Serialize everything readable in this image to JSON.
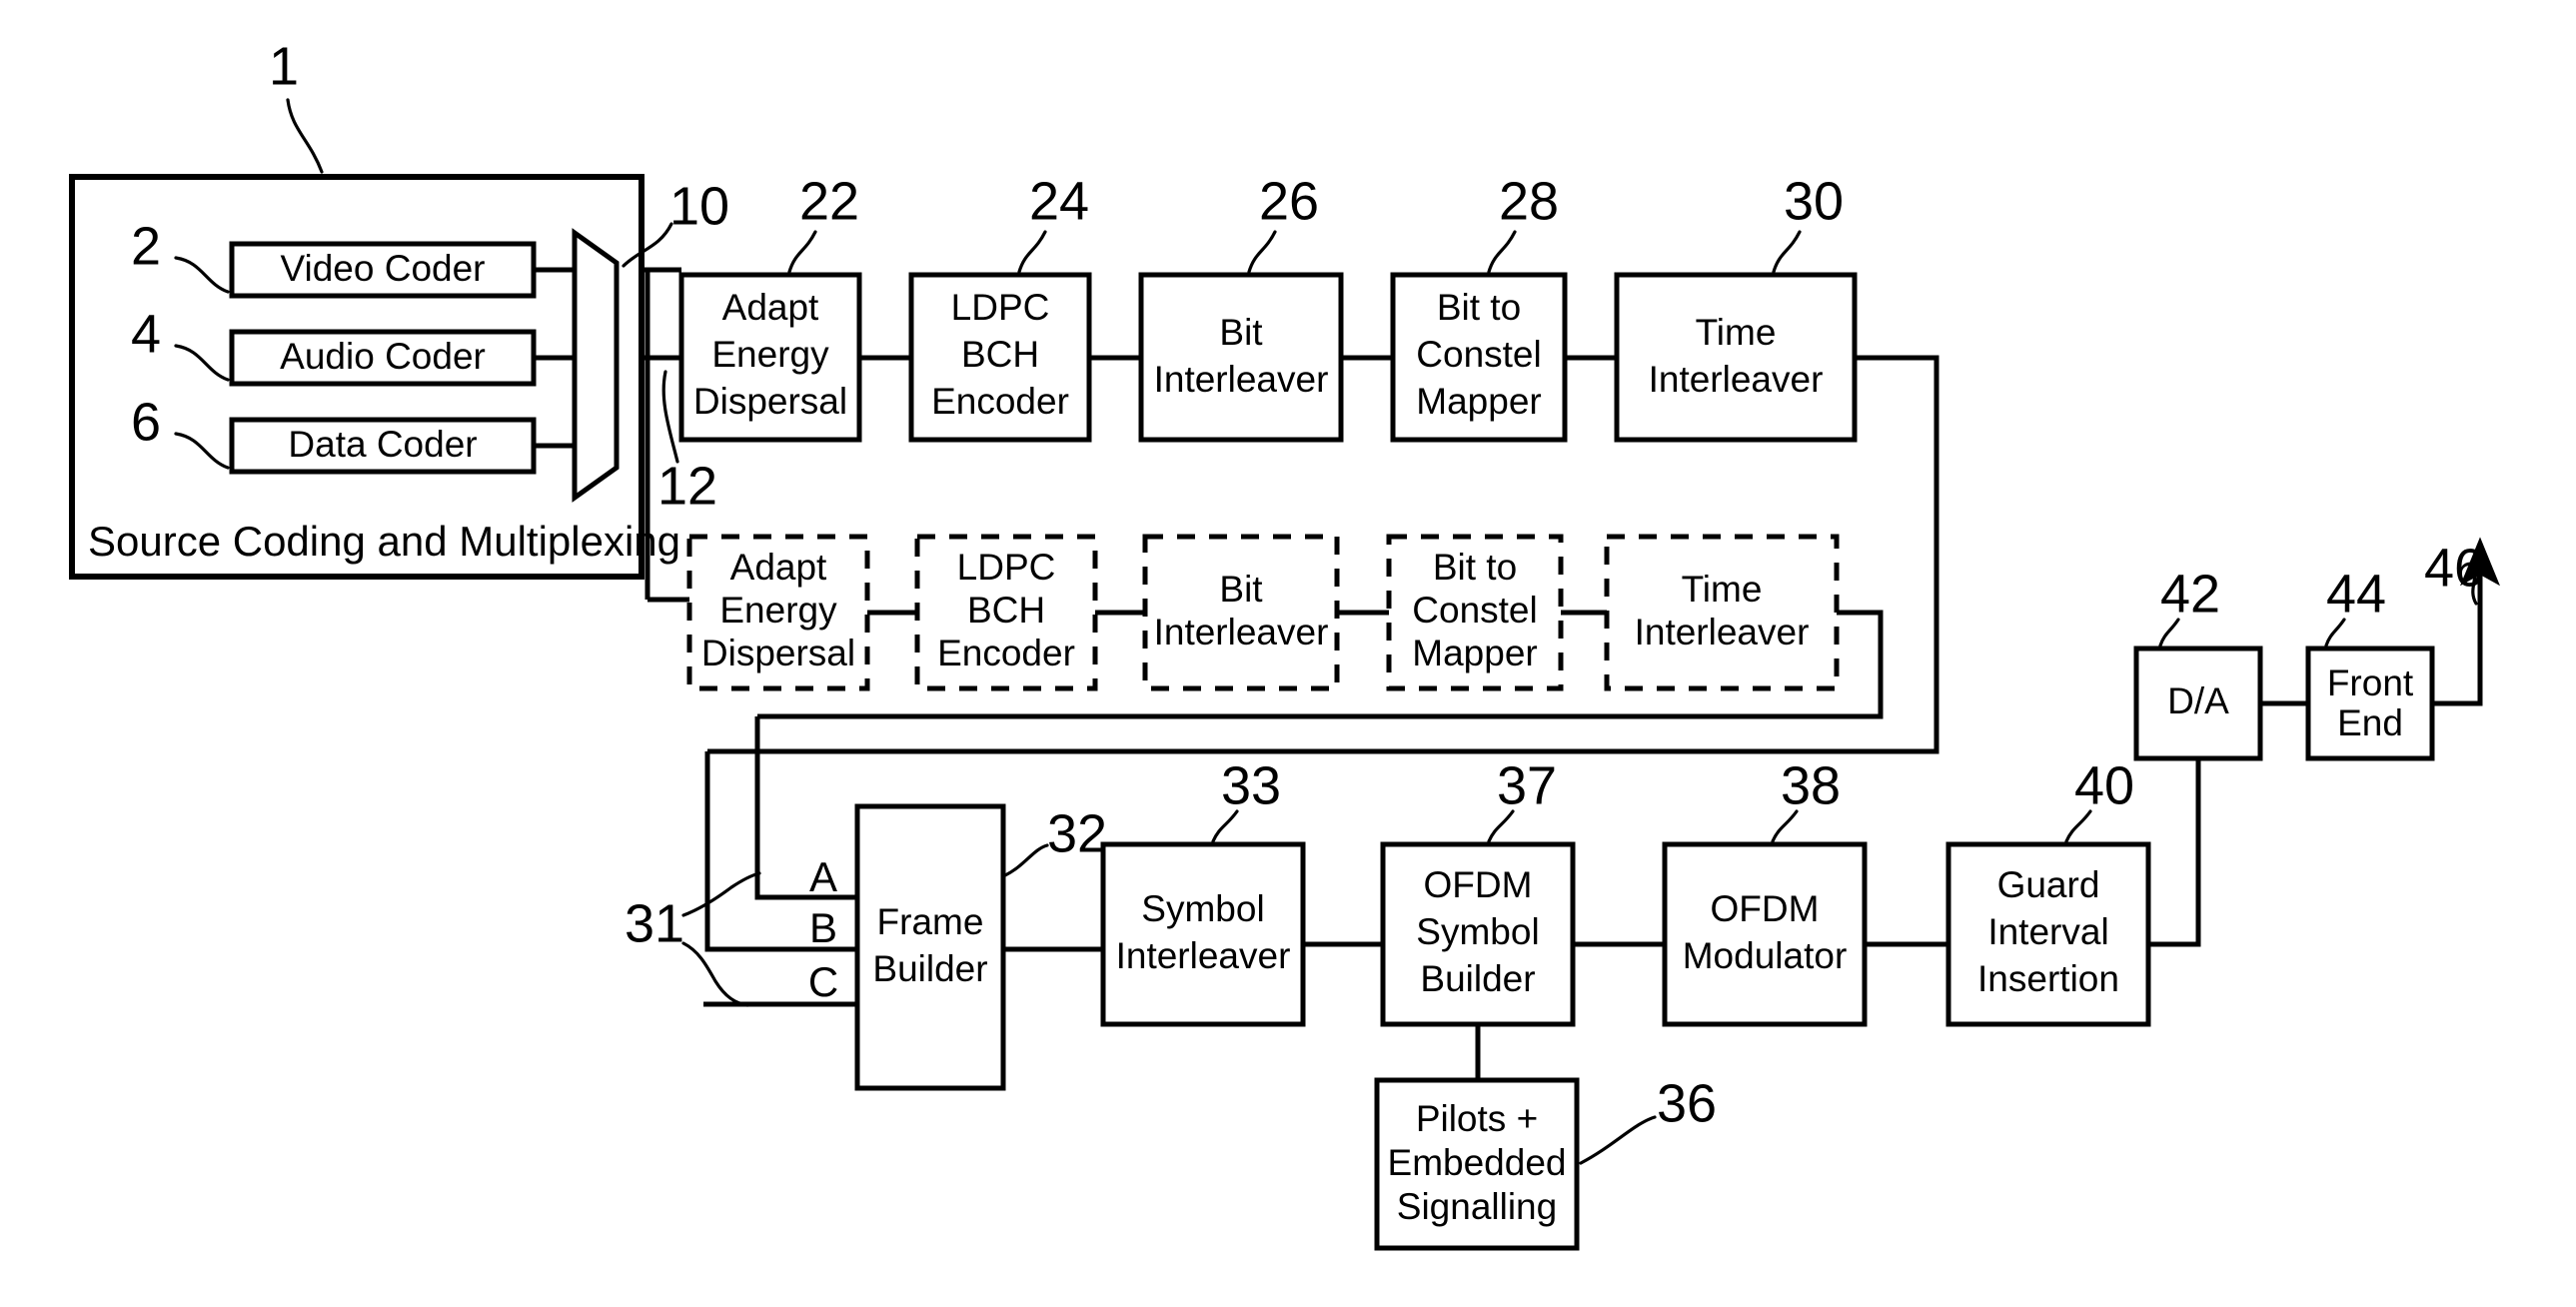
{
  "figure": {
    "type": "block-diagram",
    "title_visible": false,
    "background_color": "#ffffff",
    "line_color": "#000000"
  },
  "source_coding": {
    "ref": "1",
    "caption": "Source Coding and Multiplexing",
    "coders": [
      {
        "ref": "2",
        "label": "Video Coder"
      },
      {
        "ref": "4",
        "label": "Audio Coder"
      },
      {
        "ref": "6",
        "label": "Data Coder"
      }
    ],
    "mux_output_ref": "10",
    "second_path_ref": "12"
  },
  "chain_solid": [
    {
      "ref": "22",
      "lines": [
        "Adapt",
        "Energy",
        "Dispersal"
      ]
    },
    {
      "ref": "24",
      "lines": [
        "LDPC",
        "BCH",
        "Encoder"
      ]
    },
    {
      "ref": "26",
      "lines": [
        "Bit",
        "Interleaver"
      ]
    },
    {
      "ref": "28",
      "lines": [
        "Bit to",
        "Constel",
        "Mapper"
      ]
    },
    {
      "ref": "30",
      "lines": [
        "Time",
        "Interleaver"
      ]
    }
  ],
  "chain_dashed": [
    {
      "lines": [
        "Adapt",
        "Energy",
        "Dispersal"
      ]
    },
    {
      "lines": [
        "LDPC",
        "BCH",
        "Encoder"
      ]
    },
    {
      "lines": [
        "Bit",
        "Interleaver"
      ]
    },
    {
      "lines": [
        "Bit to",
        "Constel",
        "Mapper"
      ]
    },
    {
      "lines": [
        "Time",
        "Interleaver"
      ]
    }
  ],
  "frame_builder": {
    "ref": "32",
    "inputs_ref": "31",
    "lines": [
      "Frame",
      "Builder"
    ],
    "ports": [
      "A",
      "B",
      "C"
    ]
  },
  "chain_bottom": [
    {
      "ref": "33",
      "lines": [
        "Symbol",
        "Interleaver"
      ]
    },
    {
      "ref": "37",
      "lines": [
        "OFDM",
        "Symbol",
        "Builder"
      ]
    },
    {
      "ref": "38",
      "lines": [
        "OFDM",
        "Modulator"
      ]
    },
    {
      "ref": "40",
      "lines": [
        "Guard",
        "Interval",
        "Insertion"
      ]
    }
  ],
  "pilots": {
    "ref": "36",
    "lines": [
      "Pilots +",
      "Embedded",
      "Signalling"
    ]
  },
  "output_stage": [
    {
      "ref": "42",
      "lines": [
        "D/A"
      ]
    },
    {
      "ref": "44",
      "lines": [
        "Front",
        "End"
      ]
    }
  ],
  "antenna": {
    "ref": "46"
  }
}
